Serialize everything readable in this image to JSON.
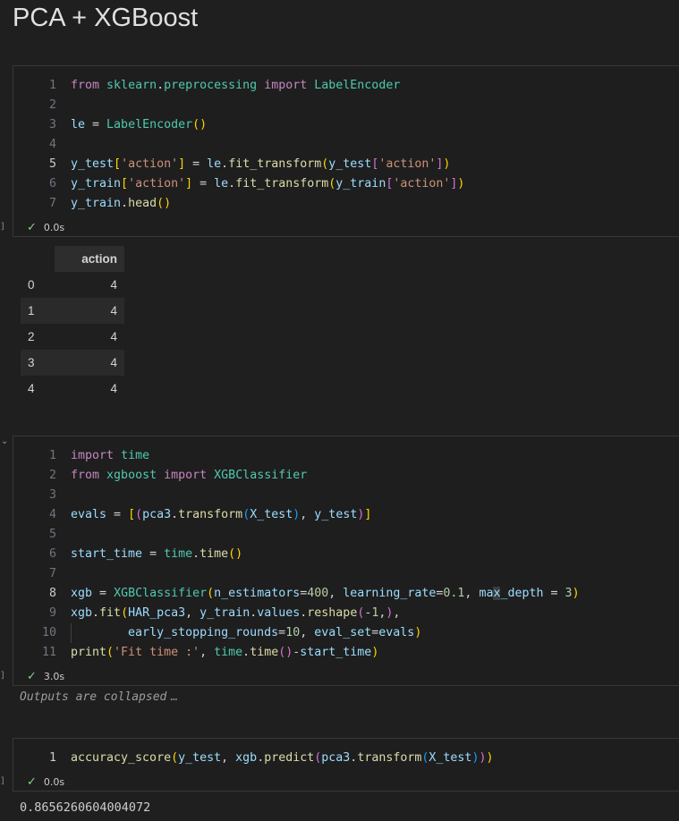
{
  "heading": "PCA + XGBoost",
  "cells": [
    {
      "status_time": "0.0s",
      "exec_mark": "]",
      "lines": [
        {
          "n": "1",
          "t": "from sklearn.preprocessing import LabelEncoder"
        },
        {
          "n": "2",
          "t": ""
        },
        {
          "n": "3",
          "t": "le = LabelEncoder()"
        },
        {
          "n": "4",
          "t": ""
        },
        {
          "n": "5",
          "t": "y_test['action'] = le.fit_transform(y_test['action'])"
        },
        {
          "n": "6",
          "t": "y_train['action'] = le.fit_transform(y_train['action'])"
        },
        {
          "n": "7",
          "t": "y_train.head()"
        }
      ]
    },
    {
      "status_time": "3.0s",
      "exec_mark": "]",
      "lines": [
        {
          "n": "1",
          "t": "import time"
        },
        {
          "n": "2",
          "t": "from xgboost import XGBClassifier"
        },
        {
          "n": "3",
          "t": ""
        },
        {
          "n": "4",
          "t": "evals = [(pca3.transform(X_test), y_test)]"
        },
        {
          "n": "5",
          "t": ""
        },
        {
          "n": "6",
          "t": "start_time = time.time()"
        },
        {
          "n": "7",
          "t": ""
        },
        {
          "n": "8",
          "t": "xgb = XGBClassifier(n_estimators=400, learning_rate=0.1, max_depth = 3)"
        },
        {
          "n": "9",
          "t": "xgb.fit(HAR_pca3, y_train.values.reshape(-1,),"
        },
        {
          "n": "10",
          "t": "        early_stopping_rounds=10, eval_set=evals)"
        },
        {
          "n": "11",
          "t": "print('Fit time :', time.time()-start_time)"
        }
      ]
    },
    {
      "status_time": "0.0s",
      "exec_mark": "]",
      "lines": [
        {
          "n": "1",
          "t": "accuracy_score(y_test, xgb.predict(pca3.transform(X_test)))"
        }
      ]
    }
  ],
  "dataframe": {
    "columns": [
      "action"
    ],
    "index": [
      "0",
      "1",
      "2",
      "3",
      "4"
    ],
    "values": [
      "4",
      "4",
      "4",
      "4",
      "4"
    ]
  },
  "collapsed_text": "Outputs are collapsed",
  "collapsed_dots": "…",
  "accuracy_output": "0.8656260604004072",
  "icons": {
    "check": "✓",
    "chevron": "⌄"
  }
}
